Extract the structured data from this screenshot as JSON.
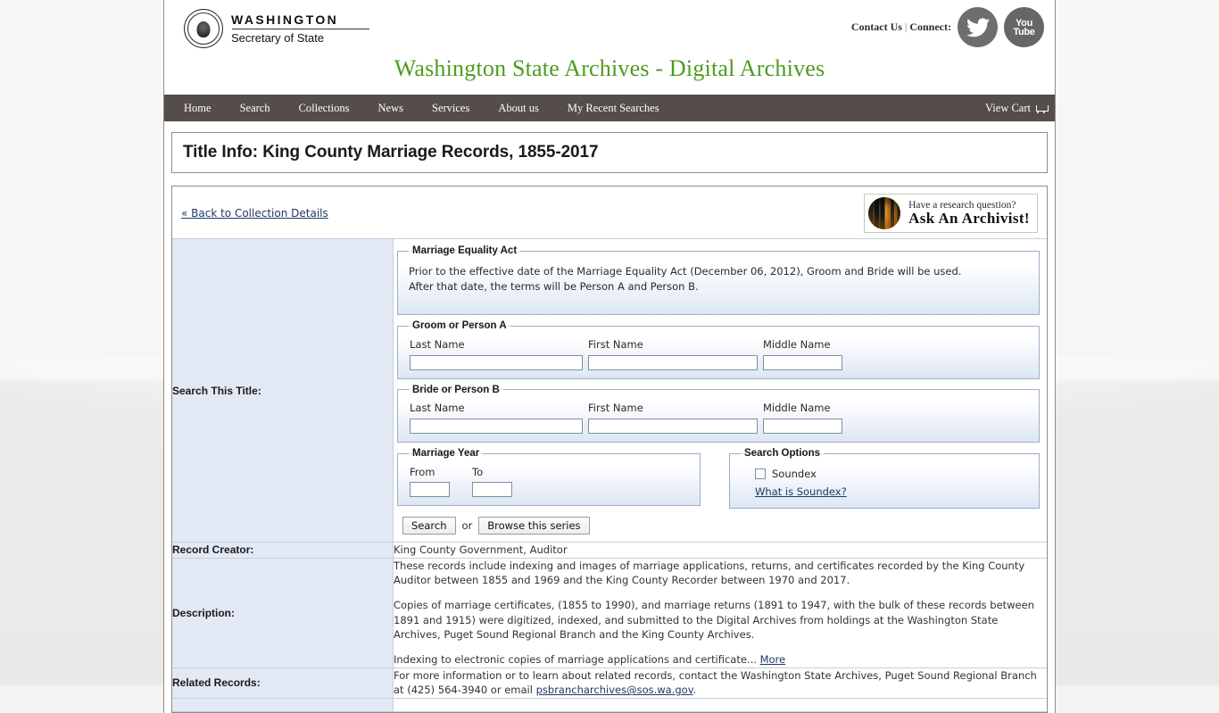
{
  "header": {
    "brand_top": "WASHINGTON",
    "brand_sub": "Secretary of State",
    "contact_label": "Contact Us",
    "separator": "|",
    "connect_label": "Connect:",
    "twitter_icon": "twitter-icon",
    "youtube_line1": "You",
    "youtube_line2": "Tube",
    "site_title": "Washington State Archives - Digital Archives"
  },
  "nav": {
    "items": [
      {
        "label": "Home"
      },
      {
        "label": "Search"
      },
      {
        "label": "Collections"
      },
      {
        "label": "News"
      },
      {
        "label": "Services"
      },
      {
        "label": "About us"
      },
      {
        "label": "My Recent Searches"
      }
    ],
    "view_cart": "View Cart"
  },
  "page": {
    "title": "Title Info: King County Marriage Records, 1855-2017",
    "back_link": "« Back to Collection Details",
    "ask_question": "Have a research question?",
    "ask_action": "Ask An Archivist!"
  },
  "search": {
    "section_label": "Search This Title:",
    "mea": {
      "legend": "Marriage Equality Act",
      "line1": "Prior to the effective date of the Marriage Equality Act (December 06, 2012), Groom and Bride will be used.",
      "line2": "After that date, the terms will be Person A and Person B."
    },
    "groom": {
      "legend": "Groom or Person A",
      "last_label": "Last Name",
      "first_label": "First Name",
      "middle_label": "Middle Name",
      "last_value": "",
      "first_value": "",
      "middle_value": ""
    },
    "bride": {
      "legend": "Bride or Person B",
      "last_label": "Last Name",
      "first_label": "First Name",
      "middle_label": "Middle Name",
      "last_value": "",
      "first_value": "",
      "middle_value": ""
    },
    "year": {
      "legend": "Marriage Year",
      "from_label": "From",
      "to_label": "To",
      "from_value": "",
      "to_value": ""
    },
    "options": {
      "legend": "Search Options",
      "soundex_label": "Soundex",
      "soundex_checked": false,
      "soundex_link": "What is Soundex?"
    },
    "search_button": "Search",
    "or_text": "or",
    "browse_button": "Browse this series"
  },
  "info": {
    "record_creator_label": "Record Creator:",
    "record_creator_value": "King County Government, Auditor",
    "description_label": "Description:",
    "description_p1": "These records include indexing and images of marriage applications, returns, and certificates recorded by the King County Auditor between 1855 and 1969 and the King County Recorder between 1970 and 2017.",
    "description_p2": "Copies of marriage certificates, (1855 to 1990), and marriage returns (1891 to 1947, with the bulk of these records between 1891 and 1915) were digitized, indexed, and submitted to the Digital Archives from holdings at the Washington State Archives, Puget Sound Regional Branch and the King County Archives.",
    "description_p3_text": "Indexing to electronic copies of marriage applications and certificate...",
    "description_more": "More",
    "related_label": "Related Records:",
    "related_text_before": "For more information or to learn about related records, contact the Washington State Archives, Puget Sound Regional Branch at (425) 564-3940 or email ",
    "related_email": "psbrancharchives@sos.wa.gov",
    "related_text_after": "."
  },
  "colors": {
    "nav_bg": "#554d4a",
    "site_title": "#4f9a1f",
    "label_cell_bg": "#e2e9f5",
    "link": "#1f3864",
    "fieldset_border": "#9bb0c9"
  }
}
